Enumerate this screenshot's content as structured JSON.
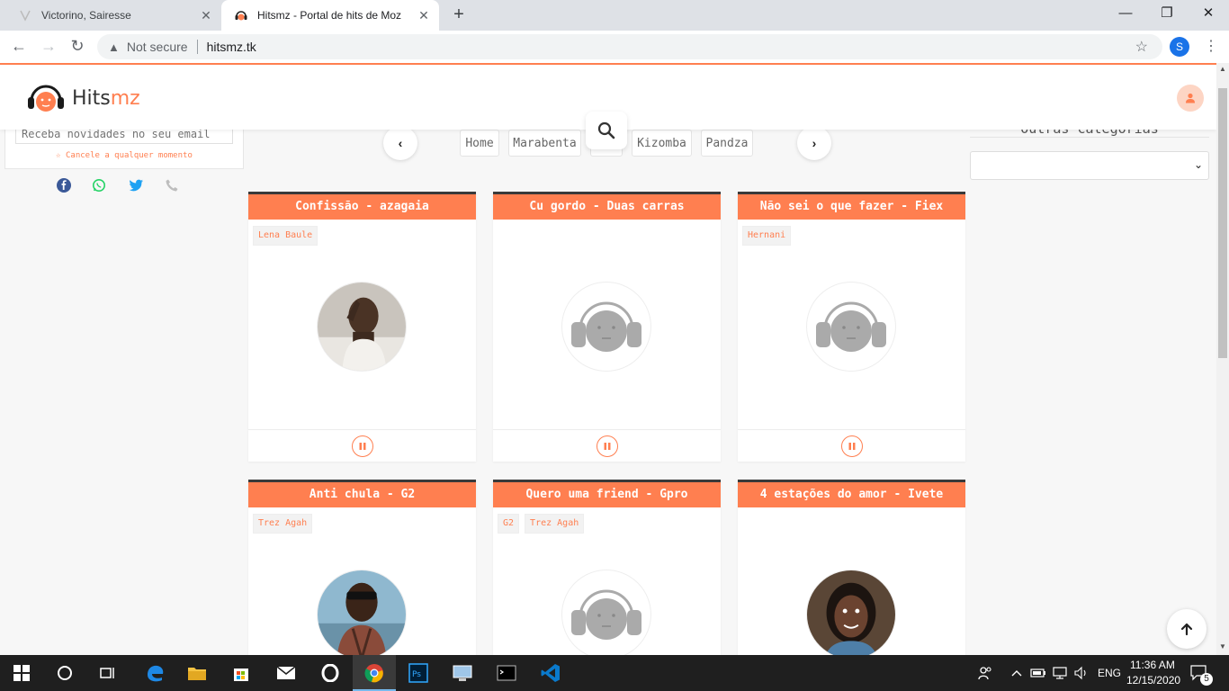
{
  "browser": {
    "tabs": [
      {
        "title": "Victorino, Sairesse",
        "active": false
      },
      {
        "title": "Hitsmz - Portal de hits de Moz",
        "active": true
      }
    ],
    "address": {
      "security": "Not secure",
      "url": "hitsmz.tk"
    },
    "profile_initial": "S"
  },
  "site": {
    "logo_part1": "Hits",
    "logo_part2": "mz",
    "newsletter_placeholder": "Receba novidades no seu email",
    "newsletter_cancel": "☆ Cancele a qualquer momento",
    "social": [
      "facebook-icon",
      "whatsapp-icon",
      "twitter-icon",
      "phone-icon"
    ],
    "categories": [
      "Home",
      "Marabenta",
      "",
      "Kizomba",
      "Pandza"
    ],
    "other_categories_title": "Outras categorias",
    "other_categories_selected": ""
  },
  "songs": [
    {
      "title": "Confissão - azagaia",
      "tags": [
        "Lena Baule"
      ],
      "cover": "photo"
    },
    {
      "title": "Cu gordo - Duas carras",
      "tags": [],
      "cover": "placeholder"
    },
    {
      "title": "Não sei o que fazer - Fiex",
      "tags": [
        "Hernani"
      ],
      "cover": "placeholder"
    },
    {
      "title": "Anti chula - G2",
      "tags": [
        "Trez Agah"
      ],
      "cover": "photo"
    },
    {
      "title": "Quero uma friend - Gpro",
      "tags": [
        "G2",
        "Trez Agah"
      ],
      "cover": "placeholder"
    },
    {
      "title": "4 estações do amor - Ivete",
      "tags": [],
      "cover": "photo"
    }
  ],
  "taskbar": {
    "lang": "ENG",
    "time": "11:36 AM",
    "date": "12/15/2020",
    "notifications": "5"
  },
  "colors": {
    "accent": "#ff7f50",
    "header_border": "#3a3a3a"
  }
}
